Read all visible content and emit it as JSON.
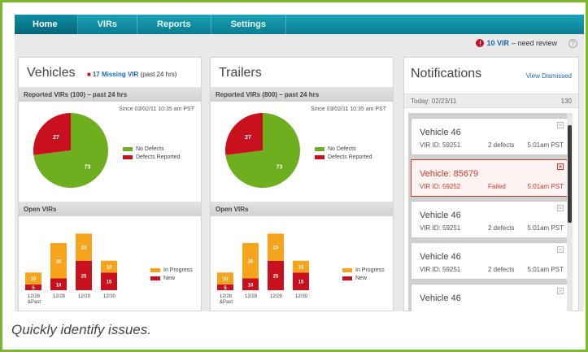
{
  "nav": {
    "tabs": [
      {
        "label": "Home",
        "active": true
      },
      {
        "label": "VIRs",
        "active": false
      },
      {
        "label": "Reports",
        "active": false
      },
      {
        "label": "Settings",
        "active": false
      }
    ]
  },
  "alert": {
    "count_link": "10 VIR",
    "text": "– need review",
    "help": "?"
  },
  "vehicles": {
    "title": "Vehicles",
    "missing_link": "17 Missing VIR",
    "missing_suffix": "(past 24 hrs)",
    "reported_header": "Reported VIRs (100) – past 24 hrs",
    "since": "Since 03/02/11 10:35 am PST",
    "open_header": "Open VIRs"
  },
  "trailers": {
    "title": "Trailers",
    "reported_header": "Reported VIRs (800) – past 24 hrs",
    "since": "Since 03/02/11 10:35 am PST",
    "open_header": "Open VIRs"
  },
  "legends": {
    "no_defects": "No Defects",
    "defects_reported": "Defects Reported",
    "in_progress": "In Progress",
    "new": "New"
  },
  "colors": {
    "green": "#6fae1e",
    "red": "#c8101e",
    "orange": "#f5a41c",
    "nav": "#0b8da1",
    "frame": "#7cb72f"
  },
  "chart_data": [
    {
      "type": "pie",
      "categories": [
        "No Defects",
        "Defects Reported"
      ],
      "values": [
        73,
        27
      ]
    },
    {
      "type": "bar",
      "stacked": true,
      "categories": [
        "12/28 &Past",
        "12/28",
        "12/29",
        "12/30"
      ],
      "series": [
        {
          "name": "New",
          "values": [
            5,
            10,
            25,
            15
          ]
        },
        {
          "name": "In Progress",
          "values": [
            10,
            30,
            23,
            10
          ]
        }
      ]
    },
    {
      "type": "pie",
      "categories": [
        "No Defects",
        "Defects Reported"
      ],
      "values": [
        73,
        27
      ]
    },
    {
      "type": "bar",
      "stacked": true,
      "categories": [
        "12/28 &Past",
        "12/28",
        "12/29",
        "12/30"
      ],
      "series": [
        {
          "name": "New",
          "values": [
            5,
            10,
            25,
            15
          ]
        },
        {
          "name": "In Progress",
          "values": [
            10,
            30,
            23,
            10
          ]
        }
      ]
    }
  ],
  "notifications": {
    "title": "Notifications",
    "view_dismissed": "View Dismissed",
    "date": "Today: 02/23/11",
    "count": "130",
    "items": [
      {
        "title": "Vehicle 46",
        "vir": "VIR ID: 59251",
        "status": "2 defects",
        "time": "5:01am PST",
        "alert": false
      },
      {
        "title": "Vehicle: 85679",
        "vir": "VIR ID: 59252",
        "status": "Failed",
        "time": "5:01am PST",
        "alert": true
      },
      {
        "title": "Vehicle 46",
        "vir": "VIR ID: 59251",
        "status": "2 defects",
        "time": "5:01am PST",
        "alert": false
      },
      {
        "title": "Vehicle 46",
        "vir": "VIR ID: 59251",
        "status": "2 defects",
        "time": "5:01am PST",
        "alert": false
      },
      {
        "title": "Vehicle 46",
        "vir": "",
        "status": "",
        "time": "",
        "alert": false
      }
    ]
  },
  "caption": "Quickly identify issues."
}
